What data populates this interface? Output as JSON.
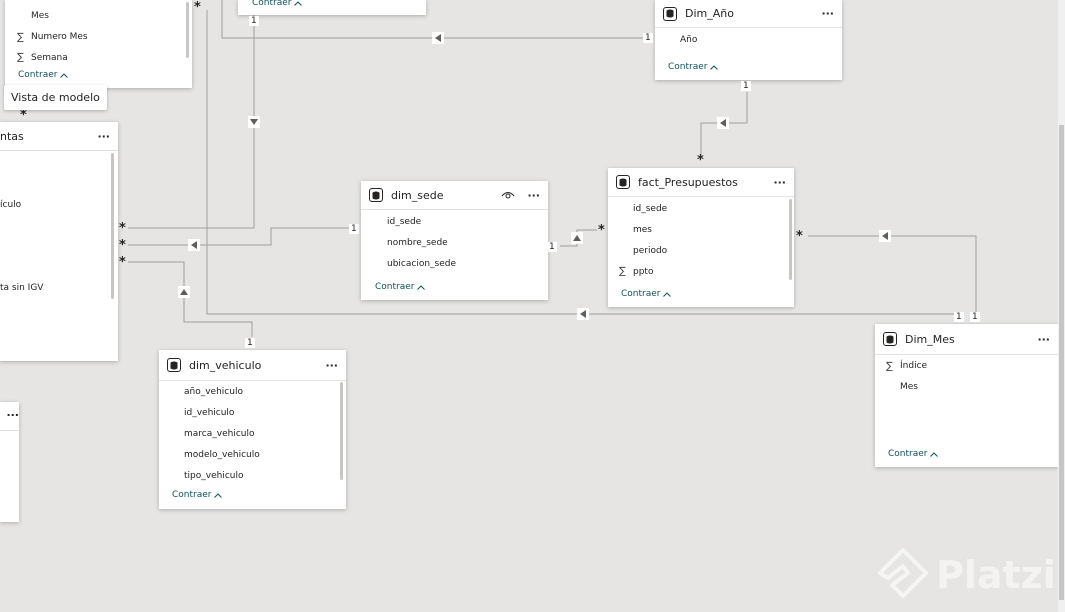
{
  "tooltip": "Vista de modelo",
  "collapse_label": "Contraer",
  "tables": {
    "calendar": {
      "fields": [
        "Mes",
        "Numero Mes",
        "Semana"
      ],
      "sigma": [
        false,
        true,
        true
      ]
    },
    "top_partial": {},
    "ventas": {
      "title": "ntas",
      "fields": [
        "",
        "",
        "ículo",
        "",
        "",
        "",
        "ta sin IGV"
      ]
    },
    "dim_anio": {
      "title": "Dim_Año",
      "fields": [
        "Año"
      ]
    },
    "dim_sede": {
      "title": "dim_sede",
      "fields": [
        "id_sede",
        "nombre_sede",
        "ubicacion_sede"
      ]
    },
    "fact_presupuestos": {
      "title": "fact_Presupuestos",
      "fields": [
        "id_sede",
        "mes",
        "periodo",
        "ppto"
      ],
      "sigma": [
        false,
        false,
        false,
        true
      ]
    },
    "dim_vehiculo": {
      "title": "dim_vehiculo",
      "fields": [
        "año_vehiculo",
        "id_vehiculo",
        "marca_vehiculo",
        "modelo_vehiculo",
        "tipo_vehiculo"
      ]
    },
    "dim_mes": {
      "title": "Dim_Mes",
      "fields": [
        "Índice",
        "Mes"
      ],
      "sigma": [
        true,
        false
      ]
    },
    "bottom_left": {
      "more": "..."
    }
  },
  "cardinality": {
    "one": "1",
    "many": "*"
  },
  "watermark": "Platzi",
  "colors": {
    "line": "#a19f9d",
    "link": "#11525d",
    "canvas": "#e6e5e3"
  },
  "icons": [
    "database-icon",
    "more-options-icon",
    "eye-icon",
    "chevron-up-icon",
    "arrow-left-icon",
    "arrow-down-icon",
    "arrow-up-icon",
    "sigma-icon",
    "platzi-logo-icon"
  ]
}
